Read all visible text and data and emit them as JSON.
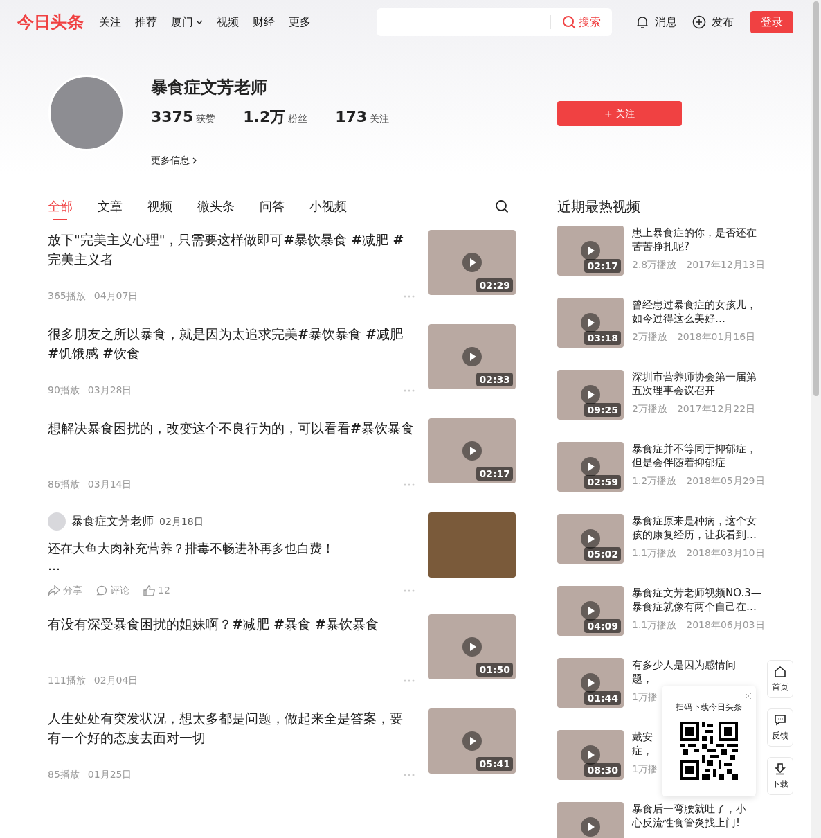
{
  "header": {
    "logo": "今日头条",
    "nav": [
      {
        "label": "关注",
        "dropdown": false
      },
      {
        "label": "推荐",
        "dropdown": false
      },
      {
        "label": "厦门",
        "dropdown": true
      },
      {
        "label": "视频",
        "dropdown": false
      },
      {
        "label": "财经",
        "dropdown": false
      },
      {
        "label": "更多",
        "dropdown": false
      }
    ],
    "search_button": "搜索",
    "messages": "消息",
    "publish": "发布",
    "login": "登录"
  },
  "profile": {
    "name": "暴食症文芳老师",
    "stats": [
      {
        "value": "3375",
        "label": "获赞"
      },
      {
        "value": "1.2万",
        "label": "粉丝"
      },
      {
        "value": "173",
        "label": "关注"
      }
    ],
    "more_info": "更多信息",
    "follow_button": "+ 关注"
  },
  "tabs": [
    {
      "label": "全部",
      "selected": true
    },
    {
      "label": "文章",
      "selected": false
    },
    {
      "label": "视频",
      "selected": false
    },
    {
      "label": "微头条",
      "selected": false
    },
    {
      "label": "问答",
      "selected": false
    },
    {
      "label": "小视频",
      "selected": false
    }
  ],
  "feed": [
    {
      "kind": "video",
      "title": "放下\"完美主义心理\"，只需要这样做即可**#**暴饮暴食 **#**减肥 **#**完美主义者",
      "views": "365播放",
      "date": "04月07日",
      "duration": "02:29"
    },
    {
      "kind": "video",
      "title": "很多朋友之所以暴食，就是因为太追求完美**#**暴饮暴食 **#**减肥 **#**饥饿感 **#**饮食",
      "views": "90播放",
      "date": "03月28日",
      "duration": "02:33"
    },
    {
      "kind": "video",
      "title": "想解决暴食困扰的，改变这个不良行为的，可以看看**#**暴饮暴食",
      "views": "86播放",
      "date": "03月14日",
      "duration": "02:17"
    },
    {
      "kind": "post",
      "author": "暴食症文芳老师",
      "date": "02月18日",
      "text": "还在大鱼大肉补充营养？排毒不畅进补再多也白费！",
      "ellipsis": "…",
      "share": "分享",
      "comment": "评论",
      "likes": "12"
    },
    {
      "kind": "video",
      "title": "有没有深受暴食困扰的姐妹啊？**#**减肥 **#**暴食 **#**暴饮暴食",
      "views": "111播放",
      "date": "02月04日",
      "duration": "01:50"
    },
    {
      "kind": "video",
      "title": "人生处处有突发状况，想太多都是问题，做起来全是答案，要有一个好的态度去面对一切",
      "views": "85播放",
      "date": "01月25日",
      "duration": "05:41"
    }
  ],
  "hot_videos": {
    "title": "近期最热视频",
    "items": [
      {
        "lines": [
          "患上暴食症的你，是否还在苦苦挣扎呢?"
        ],
        "views": "2.8万播放",
        "date": "2017年12月13日",
        "duration": "02:17"
      },
      {
        "lines": [
          "曾经患过暴食症的女孩儿，如今过得这么美好…"
        ],
        "views": "2万播放",
        "date": "2018年01月16日",
        "duration": "03:18"
      },
      {
        "lines": [
          "深圳市营养师协会第一届第五次理事会议召开"
        ],
        "views": "2万播放",
        "date": "2017年12月22日",
        "duration": "09:25"
      },
      {
        "lines": [
          "暴食症并不等同于抑郁症，但是会伴随着抑郁症"
        ],
        "views": "1.2万播放",
        "date": "2018年05月29日",
        "duration": "02:59"
      },
      {
        "lines": [
          "暴食症原来是种病，这个女孩的康复经历，让我看到…"
        ],
        "views": "1.1万播放",
        "date": "2018年03月10日",
        "duration": "05:02"
      },
      {
        "lines": [
          "暴食症文芳老师视频NO.3—暴食症就像有两个自己在…"
        ],
        "views": "1.1万播放",
        "date": "2018年06月03日",
        "duration": "04:09"
      },
      {
        "lines": [
          "有多少人是因为感情问",
          "题，"
        ],
        "views": "1万播",
        "duration": "01:44"
      },
      {
        "lines": [
          "戴安",
          "症，"
        ],
        "views": "1万播",
        "duration": "08:30"
      },
      {
        "lines": [
          "暴食后一弯腰就吐了，小",
          "心反流性食管炎找上门!"
        ]
      }
    ]
  },
  "qr_popup": {
    "title": "扫码下载今日头条"
  },
  "side_tools": [
    {
      "label": "首页"
    },
    {
      "label": "反馈"
    },
    {
      "label": "下载"
    }
  ]
}
